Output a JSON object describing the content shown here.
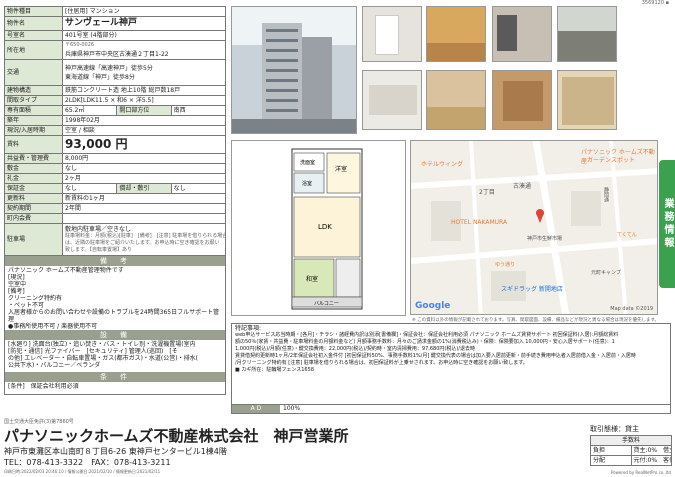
{
  "header": {
    "code": "3569120 ▪"
  },
  "spec": {
    "kind_label": "物件種目",
    "kind_value": "[住居用] マンション",
    "name_label": "物件名",
    "name_value": "サンヴェール神戸",
    "room_label": "号室名",
    "room_value": "401号室 (4階部分)",
    "address_label": "所在地",
    "address_zip": "〒650-0026",
    "address_value": "兵庫県神戸市中央区古湊通２丁目1-22",
    "transit_label": "交通",
    "transit_line1": "神戸高速線「高速神戸」徒歩5分",
    "transit_line2": "東海道線「神戸」徒歩8分",
    "structure_label": "建物構造",
    "structure_value": "鉄筋コンクリート造 地上10階 総戸数18戸",
    "layout_label": "間取タイプ",
    "layout_value": "2LDK[LDK11.5 × 和6 × 洋5.5]",
    "area_label": "専有面積",
    "area_value": "65.2㎡",
    "direction_label": "開口部方位",
    "direction_value": "南西",
    "built_label": "築年",
    "built_value": "1998年02月",
    "status_label": "現況/入居時期",
    "status_value": "空室 / 相談",
    "rent_label": "賃料",
    "rent_value": "93,000 円",
    "fee_label": "共益費・管理費",
    "fee_value": "8,000円",
    "deposit_label": "敷金",
    "deposit_value": "なし",
    "key_label": "礼金",
    "key_value": "2ヶ月",
    "guarantee_label": "保証金",
    "guarantee_value": "なし",
    "amort_label": "償却・敷引",
    "amort_value": "なし",
    "renew_label": "更新料",
    "renew_value": "新賃料の1ヶ月",
    "term_label": "契約期間",
    "term_value": "2年間",
    "school_label": "町内会費",
    "school_value": "",
    "parking_label": "駐車場",
    "parking_line1": "敷地内駐車場／空きなし",
    "parking_line2": "駐車場料金：月額(税込)[駐車]　[備考]　[注意] 駐車場を借りられる場合",
    "parking_line3": "は、近隣の駐車場をご紹介いたします。お申込時に空き確認をお願い",
    "parking_line4": "致します。【自転車置場】あり"
  },
  "notes": {
    "title": "備　考",
    "line1": "パナソニック ホームズ不動産管理物件です",
    "line2": "[現況]",
    "line3": "空室中",
    "line4": "[備考]",
    "line5": "クリーニング特約有",
    "line6": "・ペット不可",
    "line7": "入居者様からのお問い合わせや設備のトラブルを24時間365日フルサポート管理",
    "line8": "●事務所使用不可 / 楽器使用不可"
  },
  "equipment": {
    "title": "設　備",
    "line1": "[水廻り] 洗面台(独立)・追い焚き・バス・トイレ別・洗濯機置場(室内",
    "line2": "[防犯・通信] 光ファイバー　[セキュリティ] 管理人(巡回)　[そ",
    "line3": "の他] エレベーター・自転車置場・ガス(都市ガス)・水道(公営)・排水(",
    "line4": "公共下水)・バルコニー／ベランダ"
  },
  "conditions": {
    "title": "条　件",
    "line1": "[条件]　保証会社利用必須"
  },
  "remarks": {
    "title": "特記事項:",
    "line1": "web申込サービス応当時期・[各月]・チラシ・諸経費内訳は別添[書備欄]・保証会社：保証会社利用必須 パナソニック ホームズ賃貸サポート 初回保証料(入居):月額総賃料",
    "line2": "額の50％(家賃・共益費・駐車場料金の月額料金など) 月額事務手数料：月々のご請求金額の1%(消費税込み)・保険：保険要加入 10,000円・安心入居サポート(任意)：1",
    "line3": "1,000円(税込)/月額(任意)・鍵交換費用：22,000円(税込)/契約時・室内清掃費用：97,680円(税込)/退去時",
    "line4": "賃貸借契約更新時1ヶ月/2年保証会社初入金件付 [初回保証料50%、事務手数料1%/月] 鍵交換代表の場合は加入要入居前更新・前手続き費用申込者入居前借入金・入居前・入居時",
    "line5": "/月クリーニング特約有 [注意] 駐車場を借りられる場合は、初回保証料が上乗せされます。お申込時に空き確認をお願い致します。",
    "line6": "■ カギ所在：駐輪場フェンス1658"
  },
  "ad": {
    "label": "A D",
    "value": "100%"
  },
  "map": {
    "labels": [
      "ホテルウィング",
      "パナソニック ホームズ不動産",
      "ガーデンスポット",
      "古湊通",
      "2丁目",
      "HOTEL NAKAMURA",
      "神戸市生鮮市場",
      "静岡通",
      "ゆう通り",
      "スギドラッグ 新開地店",
      "元町キャンプ",
      "てくてん",
      "Google",
      "Map data ©2019"
    ],
    "footnote": "※ この資料以外の情報が記載されております。写真、間取図面、設備、備品などが現況と異なる場合は現況を優先します。"
  },
  "floorplan": {
    "rooms": [
      "洋室",
      "LDK",
      "和室",
      "洗面室",
      "浴室",
      "トイレ",
      "玄関",
      "バルコニー"
    ]
  },
  "side_tab": "業務情報",
  "footer": {
    "license": "国土交通大臣免許(3)第7860号",
    "company": "パナソニックホームズ不動産株式会社　神戸営業所",
    "address": "神戸市東灘区本山南町８丁目6-26 東神戸センタービル1棟4階",
    "tel": "TEL：078-413-3322　FAX：078-413-3211",
    "deal_title": "取引態様：貸主",
    "fee_table_title": "手数料",
    "row1_label": "負担",
    "row1_value": "貸主:0%　借主:100%",
    "row2_label": "分配",
    "row2_value": "元付:0%　客付:100%",
    "print_info": "印刷日時:2022/02/03 20:46:10 / 情報公開日:2021/02/10 / 情報更新日:2021/02/11",
    "powered": "Powered by RealNetPro co.,ltd"
  }
}
